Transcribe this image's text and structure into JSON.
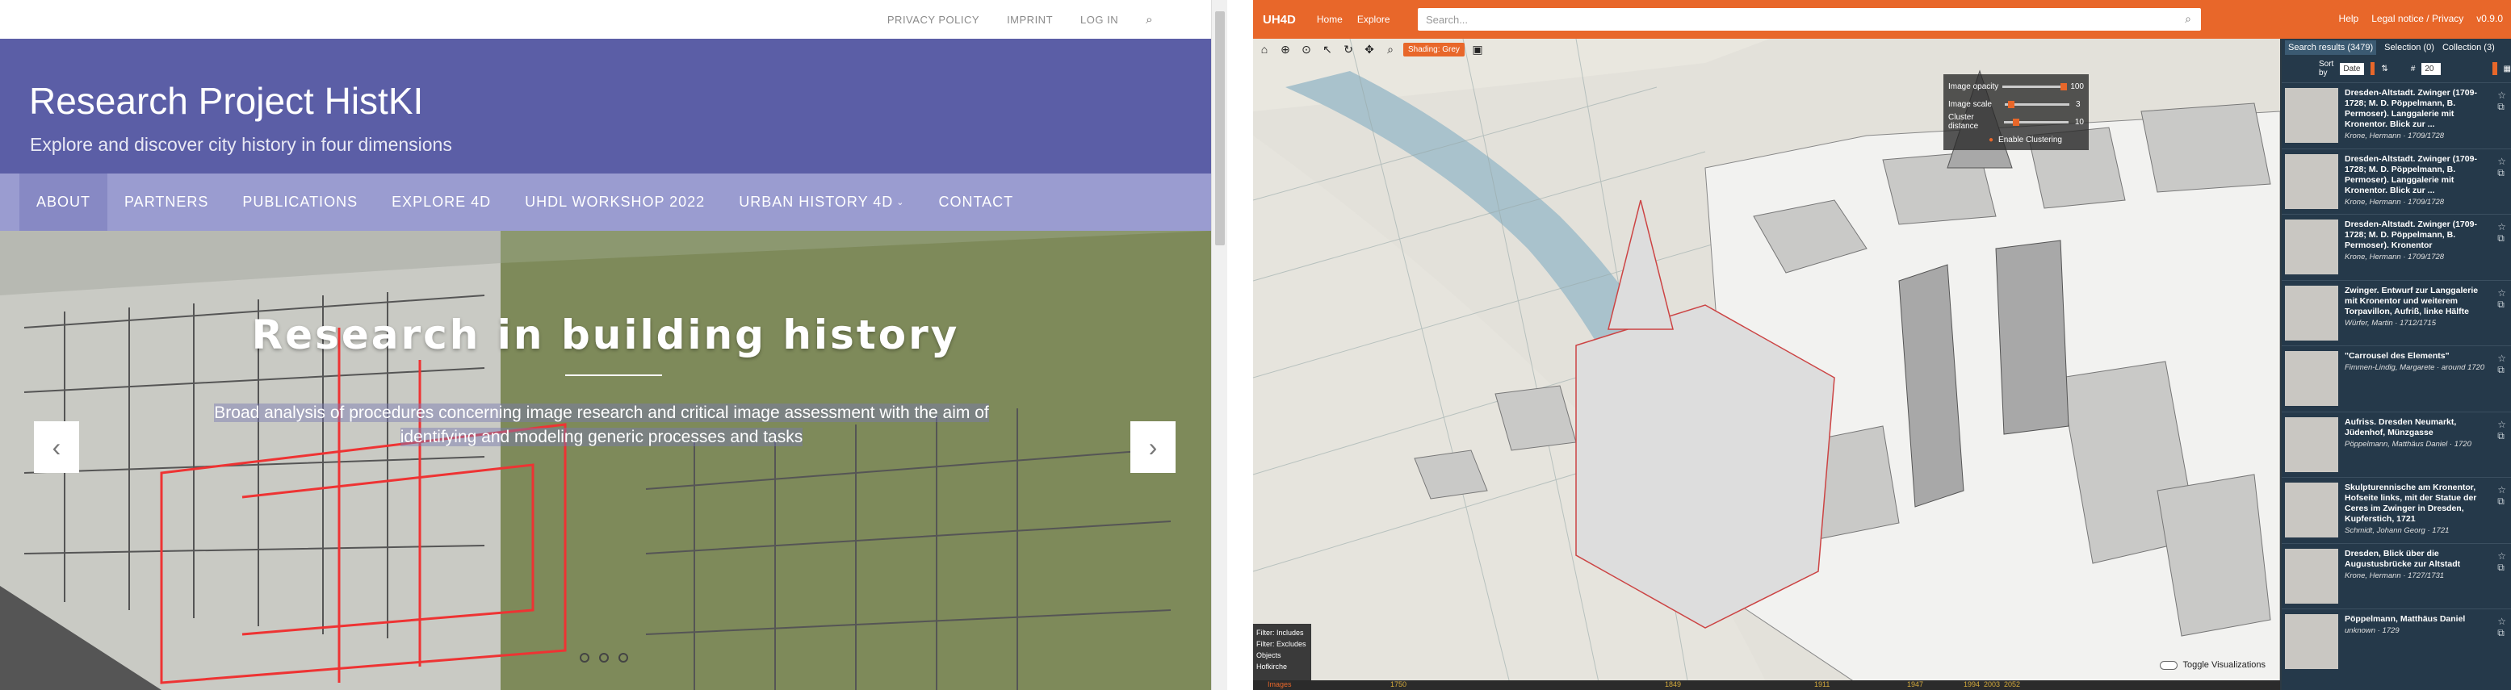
{
  "site": {
    "topbar": {
      "links": [
        "PRIVACY POLICY",
        "IMPRINT",
        "LOG IN"
      ],
      "search_glyph": "⌕"
    },
    "title": "Research Project HistKI",
    "tagline": "Explore and discover city history in four dimensions",
    "nav": [
      "ABOUT",
      "PARTNERS",
      "PUBLICATIONS",
      "EXPLORE 4D",
      "UHDL WORKSHOP 2022",
      "URBAN HISTORY 4D",
      "CONTACT"
    ],
    "slide": {
      "heading": "Research in building history",
      "subtext": "Broad analysis of procedures concerning image research and critical image assessment with the aim of identifying and modeling generic processes and tasks",
      "prev": "‹",
      "next": "›"
    },
    "colors": {
      "header": "#5b5ea6",
      "nav": "#9a9cd0"
    }
  },
  "app": {
    "logo": "UH4D",
    "menu": [
      "Home",
      "Explore"
    ],
    "search_placeholder": "Search...",
    "right_links": [
      "Help",
      "Legal notice / Privacy",
      "v0.9.0"
    ],
    "shading": "Shading: Grey",
    "sliders": [
      {
        "label": "Image opacity",
        "value": "100",
        "level": 1.0
      },
      {
        "label": "Image scale",
        "value": "3",
        "level": 0.05
      },
      {
        "label": "Cluster distance",
        "value": "10",
        "level": 0.15
      }
    ],
    "clustering": "Enable Clustering",
    "filters": [
      "Filter: Includes",
      "Filter: Excludes",
      "Objects",
      "Hofkirche"
    ],
    "toggle_label": "Toggle Visualizations",
    "timeline_labels": [
      "Images",
      "1750",
      "1849",
      "1911",
      "1947",
      "1994",
      "2003",
      "2052"
    ],
    "accent": "#e8672a",
    "panel": {
      "tabs": [
        "Search results (3479)",
        "Selection (0)",
        "Collection (3)"
      ],
      "sort_label": "Sort by",
      "sort_value": "Date",
      "count_label": "#",
      "count_value": "20"
    },
    "results": [
      {
        "title": "Dresden-Altstadt. Zwinger (1709-1728; M. D. Pöppelmann, B. Permoser). Langgalerie mit Kronentor. Blick zur ...",
        "author": "Krone, Hermann · 1709/1728"
      },
      {
        "title": "Dresden-Altstadt. Zwinger (1709-1728; M. D. Pöppelmann, B. Permoser). Langgalerie mit Kronentor. Blick zur ...",
        "author": "Krone, Hermann · 1709/1728"
      },
      {
        "title": "Dresden-Altstadt. Zwinger (1709-1728; M. D. Pöppelmann, B. Permoser). Kronentor",
        "author": "Krone, Hermann · 1709/1728"
      },
      {
        "title": "Zwinger. Entwurf zur Langgalerie mit Kronentor und weiterem Torpavillon, Aufriß, linke Hälfte",
        "author": "Würfer, Martin · 1712/1715"
      },
      {
        "title": "\"Carrousel des Elements\"",
        "author": "Fimmen-Lindig, Margarete · around 1720"
      },
      {
        "title": "Aufriss. Dresden Neumarkt, Jüdenhof, Münzgasse",
        "author": "Pöppelmann, Matthäus Daniel · 1720"
      },
      {
        "title": "Skulpturennische am Kronentor, Hofseite links, mit der Statue der Ceres im Zwinger in Dresden, Kupferstich, 1721",
        "author": "Schmidt, Johann Georg · 1721"
      },
      {
        "title": "Dresden, Blick über die Augustusbrücke zur Altstadt",
        "author": "Krone, Hermann · 1727/1731"
      },
      {
        "title": "Pöppelmann, Matthäus Daniel",
        "author": "unknown · 1729"
      }
    ]
  }
}
